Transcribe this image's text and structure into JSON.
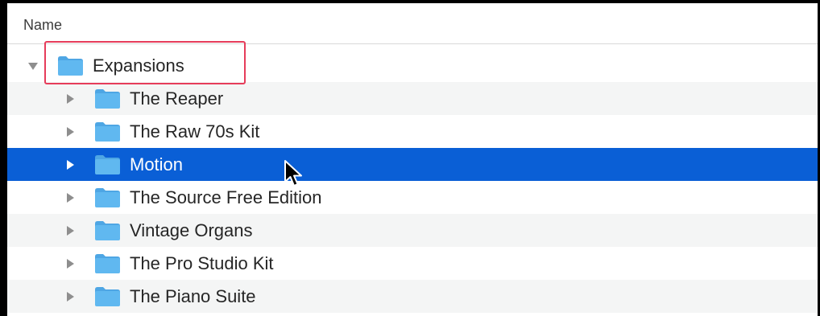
{
  "header": {
    "column_name": "Name"
  },
  "colors": {
    "selection": "#0a5fd6",
    "folder": "#60b8f0",
    "highlight_box": "#e63c5a"
  },
  "rows": [
    {
      "label": "Expansions",
      "expanded": true,
      "indent": 0,
      "icon": "folder-icon"
    },
    {
      "label": "The Reaper",
      "expanded": false,
      "indent": 1,
      "icon": "folder-icon"
    },
    {
      "label": "The Raw 70s Kit",
      "expanded": false,
      "indent": 1,
      "icon": "folder-icon"
    },
    {
      "label": "Motion",
      "expanded": false,
      "indent": 1,
      "icon": "folder-icon",
      "selected": true
    },
    {
      "label": "The Source Free Edition",
      "expanded": false,
      "indent": 1,
      "icon": "folder-icon"
    },
    {
      "label": "Vintage Organs",
      "expanded": false,
      "indent": 1,
      "icon": "folder-icon"
    },
    {
      "label": "The Pro Studio Kit",
      "expanded": false,
      "indent": 1,
      "icon": "folder-icon"
    },
    {
      "label": "The Piano Suite",
      "expanded": false,
      "indent": 1,
      "icon": "folder-icon"
    }
  ]
}
